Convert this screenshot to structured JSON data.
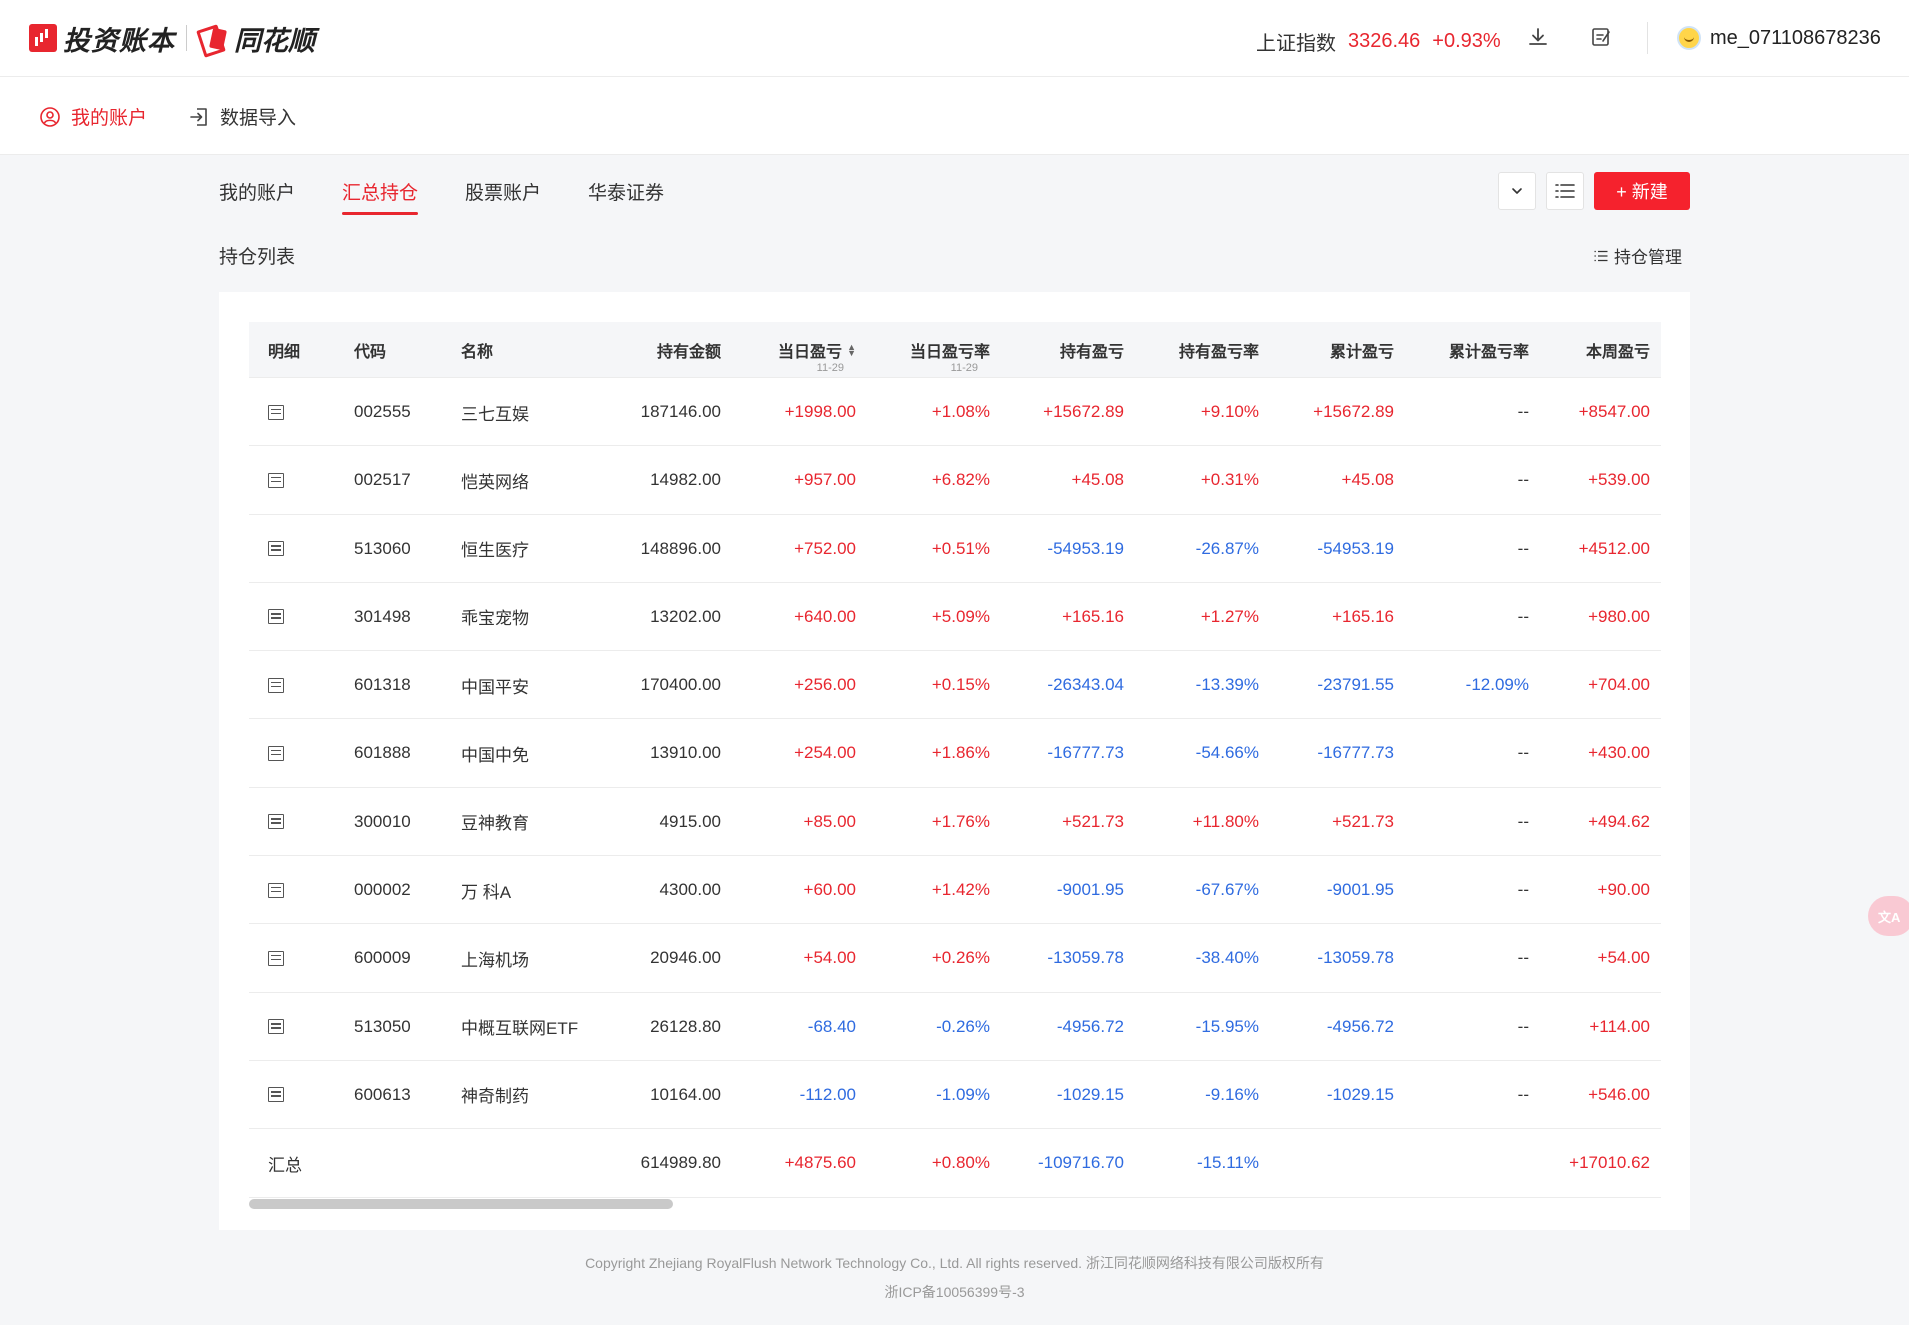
{
  "header": {
    "brand_title": "投资账本",
    "brand_partner": "同花顺",
    "index_label": "上证指数",
    "index_value": "3326.46",
    "index_change": "+0.93%",
    "username": "me_071108678236",
    "download_icon": "download-icon",
    "edit_icon": "edit-note-icon"
  },
  "subnav": {
    "my_account": "我的账户",
    "data_import": "数据导入"
  },
  "tabs": [
    "我的账户",
    "汇总持仓",
    "股票账户",
    "华泰证券"
  ],
  "toolbar": {
    "new_label": "+ 新建"
  },
  "section": {
    "title": "持仓列表",
    "manage_label": "持仓管理"
  },
  "table": {
    "columns": [
      "明细",
      "代码",
      "名称",
      "持有金额",
      "当日盈亏",
      "当日盈亏率",
      "持有盈亏",
      "持有盈亏率",
      "累计盈亏",
      "累计盈亏率",
      "本周盈亏"
    ],
    "column_date": "11-29",
    "rows": [
      {
        "code": "002555",
        "name": "三七互娱",
        "amount": "187146.00",
        "day_pl": "+1998.00",
        "day_rate": "+1.08%",
        "hold_pl": "+15672.89",
        "hold_rate": "+9.10%",
        "cum_pl": "+15672.89",
        "cum_rate": "--",
        "week_pl": "+8547.00"
      },
      {
        "code": "002517",
        "name": "恺英网络",
        "amount": "14982.00",
        "day_pl": "+957.00",
        "day_rate": "+6.82%",
        "hold_pl": "+45.08",
        "hold_rate": "+0.31%",
        "cum_pl": "+45.08",
        "cum_rate": "--",
        "week_pl": "+539.00"
      },
      {
        "code": "513060",
        "name": "恒生医疗",
        "amount": "148896.00",
        "day_pl": "+752.00",
        "day_rate": "+0.51%",
        "hold_pl": "-54953.19",
        "hold_rate": "-26.87%",
        "cum_pl": "-54953.19",
        "cum_rate": "--",
        "week_pl": "+4512.00"
      },
      {
        "code": "301498",
        "name": "乖宝宠物",
        "amount": "13202.00",
        "day_pl": "+640.00",
        "day_rate": "+5.09%",
        "hold_pl": "+165.16",
        "hold_rate": "+1.27%",
        "cum_pl": "+165.16",
        "cum_rate": "--",
        "week_pl": "+980.00"
      },
      {
        "code": "601318",
        "name": "中国平安",
        "amount": "170400.00",
        "day_pl": "+256.00",
        "day_rate": "+0.15%",
        "hold_pl": "-26343.04",
        "hold_rate": "-13.39%",
        "cum_pl": "-23791.55",
        "cum_rate": "-12.09%",
        "week_pl": "+704.00"
      },
      {
        "code": "601888",
        "name": "中国中免",
        "amount": "13910.00",
        "day_pl": "+254.00",
        "day_rate": "+1.86%",
        "hold_pl": "-16777.73",
        "hold_rate": "-54.66%",
        "cum_pl": "-16777.73",
        "cum_rate": "--",
        "week_pl": "+430.00"
      },
      {
        "code": "300010",
        "name": "豆神教育",
        "amount": "4915.00",
        "day_pl": "+85.00",
        "day_rate": "+1.76%",
        "hold_pl": "+521.73",
        "hold_rate": "+11.80%",
        "cum_pl": "+521.73",
        "cum_rate": "--",
        "week_pl": "+494.62"
      },
      {
        "code": "000002",
        "name": "万 科A",
        "amount": "4300.00",
        "day_pl": "+60.00",
        "day_rate": "+1.42%",
        "hold_pl": "-9001.95",
        "hold_rate": "-67.67%",
        "cum_pl": "-9001.95",
        "cum_rate": "--",
        "week_pl": "+90.00"
      },
      {
        "code": "600009",
        "name": "上海机场",
        "amount": "20946.00",
        "day_pl": "+54.00",
        "day_rate": "+0.26%",
        "hold_pl": "-13059.78",
        "hold_rate": "-38.40%",
        "cum_pl": "-13059.78",
        "cum_rate": "--",
        "week_pl": "+54.00"
      },
      {
        "code": "513050",
        "name": "中概互联网ETF",
        "amount": "26128.80",
        "day_pl": "-68.40",
        "day_rate": "-0.26%",
        "hold_pl": "-4956.72",
        "hold_rate": "-15.95%",
        "cum_pl": "-4956.72",
        "cum_rate": "--",
        "week_pl": "+114.00"
      },
      {
        "code": "600613",
        "name": "神奇制药",
        "amount": "10164.00",
        "day_pl": "-112.00",
        "day_rate": "-1.09%",
        "hold_pl": "-1029.15",
        "hold_rate": "-9.16%",
        "cum_pl": "-1029.15",
        "cum_rate": "--",
        "week_pl": "+546.00"
      }
    ],
    "summary": {
      "label": "汇总",
      "amount": "614989.80",
      "day_pl": "+4875.60",
      "day_rate": "+0.80%",
      "hold_pl": "-109716.70",
      "hold_rate": "-15.11%",
      "cum_pl": "",
      "cum_rate": "",
      "week_pl": "+17010.62"
    }
  },
  "footer": {
    "copyright": "Copyright Zhejiang RoyalFlush Network Technology Co., Ltd. All rights reserved. 浙江同花顺网络科技有限公司版权所有",
    "icp": "浙ICP备10056399号-3"
  },
  "colors": {
    "accent": "#e8262f",
    "up": "#e8262f",
    "down": "#2f6be0"
  }
}
